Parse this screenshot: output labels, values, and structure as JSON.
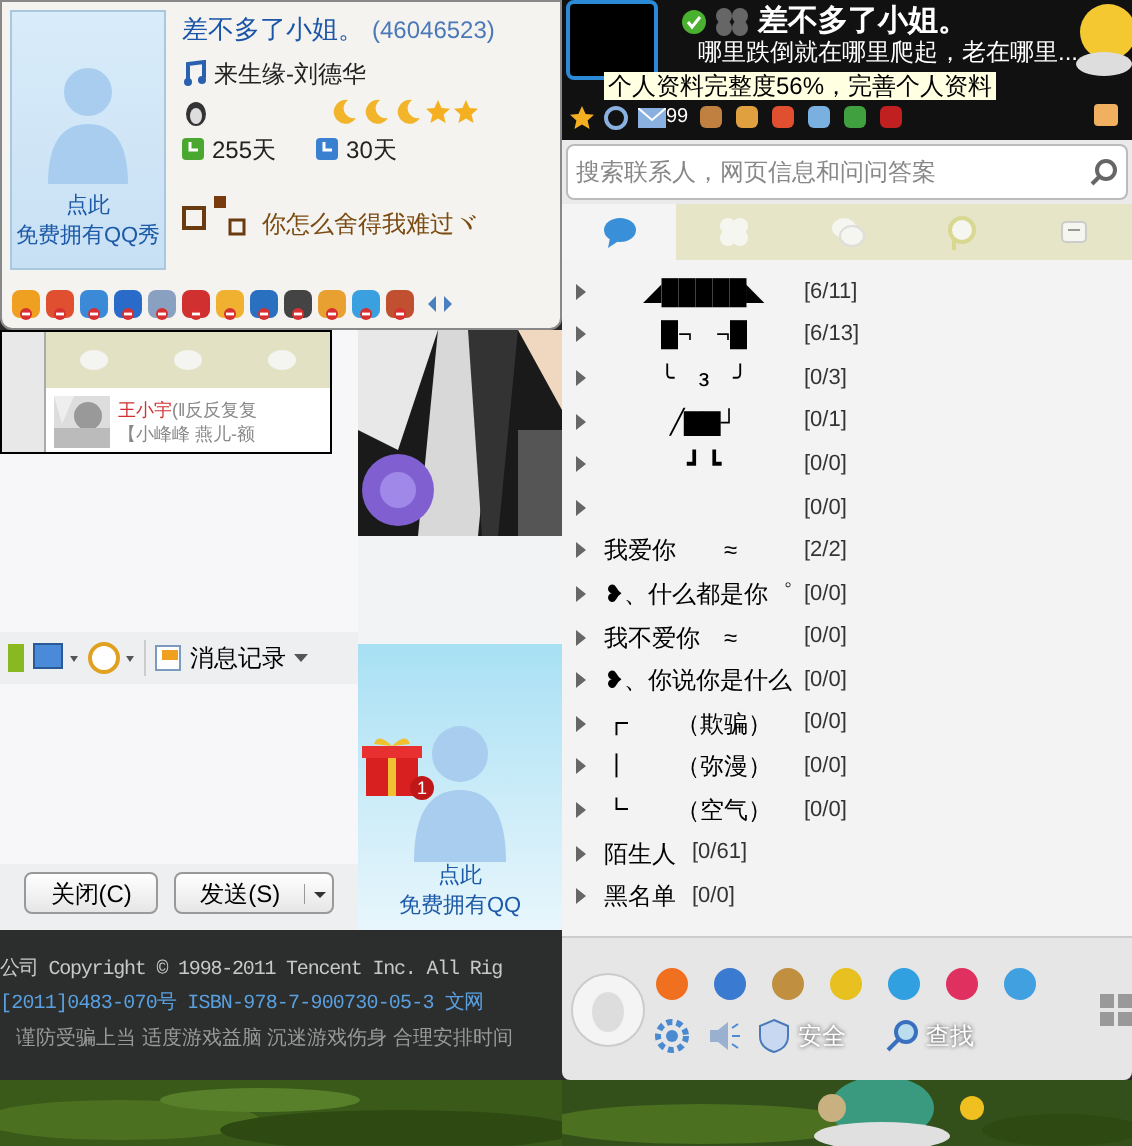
{
  "profile_card": {
    "nickname": "差不多了小姐。",
    "qq_number": "(46046523)",
    "song": "来生缘-刘德华",
    "days_a": "255天",
    "days_b": "30天",
    "signature": "你怎么舍得我难过ヾ",
    "qq_show": [
      "点此",
      "免费拥有QQ秀"
    ]
  },
  "chat_window": {
    "mini_contact": {
      "name": "王小宇",
      "status": "(‖反反复复",
      "message": "【小峰峰 燕儿-额"
    },
    "history_button": "消息记录",
    "buttons": [
      "关闭(C)",
      "发送(S)"
    ]
  },
  "side_show": {
    "lines": [
      "点此",
      "免费拥有QQ"
    ],
    "gift_badge": "1"
  },
  "footer": [
    "公司 Copyright © 1998-2011 Tencent Inc. All Rig",
    "[2011]0483-070号 ISBN-978-7-900730-05-3 文网",
    "谨防受骗上当  适度游戏益脑  沉迷游戏伤身  合理安排时间"
  ],
  "main_panel": {
    "nickname": "差不多了小姐。",
    "signature": "哪里跌倒就在哪里爬起，老在哪里...",
    "tooltip": "个人资料完整度56%，完善个人资料",
    "mail_count": "99",
    "search": {
      "placeholder": "搜索联系人，网页信息和问问答案"
    },
    "tabs": [
      {
        "kind": "chat",
        "selected": true
      },
      {
        "kind": "clover",
        "selected": false
      },
      {
        "kind": "bubbles",
        "selected": false
      },
      {
        "kind": "pin",
        "selected": false
      },
      {
        "kind": "list",
        "selected": false
      }
    ],
    "groups": [
      {
        "kind": "art",
        "name": "◢█████◣",
        "count": "[6/11]"
      },
      {
        "kind": "art",
        "name": "█¬　¬█",
        "count": "[6/13]"
      },
      {
        "kind": "art",
        "name": "╰　з　╯",
        "count": "[0/3]"
      },
      {
        "kind": "art",
        "name": "╱▇▇┘",
        "count": "[0/1]"
      },
      {
        "kind": "art",
        "name": "┛ ┗",
        "count": "[0/0]"
      },
      {
        "kind": "art",
        "count": "[0/0]"
      },
      {
        "kind": "aligned",
        "name": "我爱你　　≈",
        "count": "[2/2]"
      },
      {
        "kind": "aligned",
        "name": "❥、什么都是你゜",
        "count": "[0/0]"
      },
      {
        "kind": "aligned",
        "name": "我不爱你　≈",
        "count": "[0/0]"
      },
      {
        "kind": "aligned",
        "name": "❥、你说你是什么",
        "count": "[0/0]"
      },
      {
        "kind": "aligned",
        "name": "┏　　（欺骗）",
        "count": "[0/0]"
      },
      {
        "kind": "aligned",
        "name": "┃　　（弥漫）",
        "count": "[0/0]"
      },
      {
        "kind": "aligned",
        "name": "┗　　（空气）",
        "count": "[0/0]"
      },
      {
        "kind": "inline",
        "name": "陌生人",
        "count": "[0/61]"
      },
      {
        "kind": "inline",
        "name": "黑名单",
        "count": "[0/0]"
      }
    ],
    "bottom_buttons": [
      "安全",
      "查找"
    ]
  }
}
